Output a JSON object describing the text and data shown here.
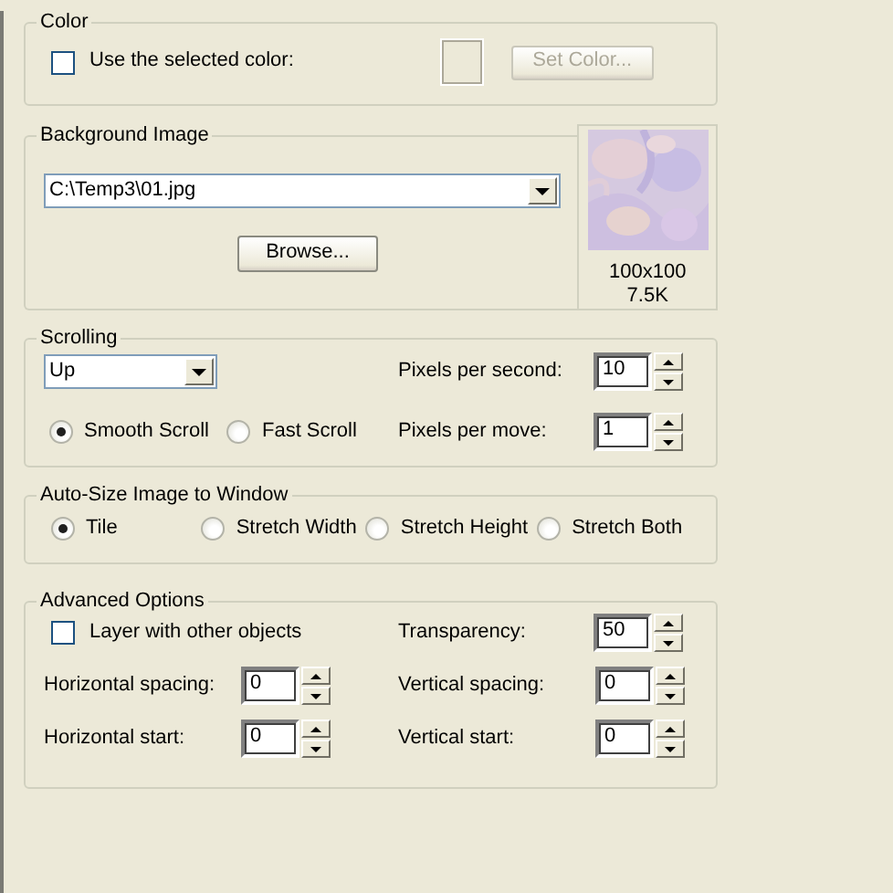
{
  "color_group": {
    "title": "Color",
    "use_selected": {
      "label": "Use the selected color:",
      "checked": false
    },
    "swatch": {
      "disabled": true
    },
    "set_color": {
      "label": "Set Color...",
      "disabled": true
    }
  },
  "background_image": {
    "title": "Background Image",
    "path": "C:\\Temp3\\01.jpg",
    "browse": "Browse...",
    "preview": {
      "kind": "picture",
      "dimensions": "100x100",
      "size": "7.5K"
    }
  },
  "scrolling": {
    "title": "Scrolling",
    "direction": "Up",
    "modes": [
      {
        "label": "Smooth Scroll",
        "selected": true
      },
      {
        "label": "Fast Scroll",
        "selected": false
      }
    ],
    "spinners": [
      {
        "label": "Pixels per second:",
        "value": "10"
      },
      {
        "label": "Pixels per move:",
        "value": "1"
      }
    ]
  },
  "auto_size": {
    "title": "Auto-Size Image to Window",
    "options": [
      {
        "label": "Tile",
        "selected": true
      },
      {
        "label": "Stretch Width",
        "selected": false
      },
      {
        "label": "Stretch Height",
        "selected": false
      },
      {
        "label": "Stretch Both",
        "selected": false
      }
    ]
  },
  "advanced": {
    "title": "Advanced Options",
    "layer": {
      "label": "Layer with other objects",
      "checked": false
    },
    "transparency": {
      "label": "Transparency:",
      "value": "50"
    },
    "spinners": [
      {
        "label": "Horizontal spacing:",
        "value": "0"
      },
      {
        "label": "Vertical spacing:",
        "value": "0"
      },
      {
        "label": "Horizontal start:",
        "value": "0"
      },
      {
        "label": "Vertical start:",
        "value": "0"
      }
    ]
  }
}
